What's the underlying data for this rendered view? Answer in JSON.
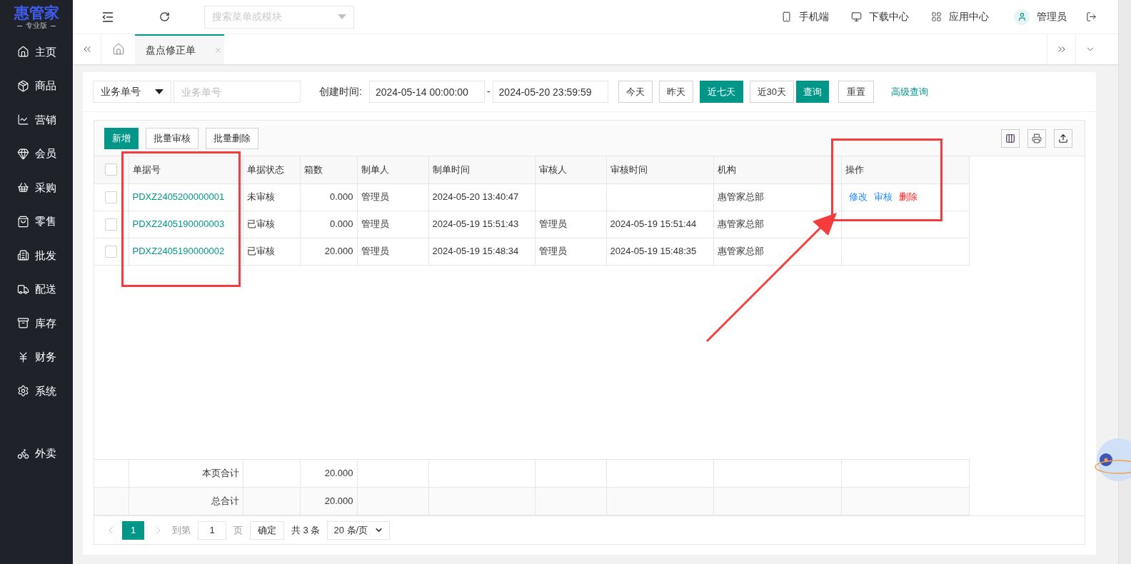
{
  "logo": {
    "title": "惠管家",
    "subtitle": "专业版"
  },
  "sidebar": {
    "items": [
      {
        "label": "主页"
      },
      {
        "label": "商品"
      },
      {
        "label": "营销"
      },
      {
        "label": "会员"
      },
      {
        "label": "采购"
      },
      {
        "label": "零售"
      },
      {
        "label": "批发"
      },
      {
        "label": "配送"
      },
      {
        "label": "库存"
      },
      {
        "label": "财务"
      },
      {
        "label": "系统"
      }
    ],
    "bottom_items": [
      {
        "label": "外卖"
      }
    ]
  },
  "topbar": {
    "search_placeholder": "搜索菜单或模块",
    "links": [
      {
        "label": "手机端"
      },
      {
        "label": "下载中心"
      },
      {
        "label": "应用中心"
      }
    ],
    "user": "管理员"
  },
  "tabs": [
    {
      "label": "盘点修正单",
      "selected": true
    }
  ],
  "filter": {
    "field_select": "业务单号",
    "field_placeholder": "业务单号",
    "created_label": "创建时间:",
    "start": "2024-05-14 00:00:00",
    "separator": "-",
    "end": "2024-05-20 23:59:59",
    "date_ranges": [
      {
        "label": "今天",
        "selected": false
      },
      {
        "label": "昨天",
        "selected": false
      },
      {
        "label": "近七天",
        "selected": true
      },
      {
        "label": "近30天",
        "selected": false
      }
    ],
    "query": "查询",
    "reset": "重置",
    "advanced": "高级查询"
  },
  "toolbar": [
    {
      "label": "新增",
      "kind": "primary"
    },
    {
      "label": "批量审核",
      "kind": "default"
    },
    {
      "label": "批量删除",
      "kind": "default"
    }
  ],
  "table": {
    "select_all_checked": false,
    "columns": [
      "单据号",
      "单据状态",
      "箱数",
      "制单人",
      "制单时间",
      "审核人",
      "审核时间",
      "机构",
      "操作"
    ],
    "rows": [
      {
        "checked": false,
        "cells": [
          "PDXZ2405200000001",
          "未审核",
          "0.000",
          "管理员",
          "2024-05-20 13:40:47",
          "",
          "",
          "惠管家总部"
        ],
        "actions": [
          {
            "label": "修改",
            "kind": "link"
          },
          {
            "label": "审核",
            "kind": "link"
          },
          {
            "label": "删除",
            "kind": "danger"
          }
        ]
      },
      {
        "checked": false,
        "cells": [
          "PDXZ2405190000003",
          "已审核",
          "0.000",
          "管理员",
          "2024-05-19 15:51:43",
          "管理员",
          "2024-05-19 15:51:44",
          "惠管家总部"
        ],
        "actions": []
      },
      {
        "checked": false,
        "cells": [
          "PDXZ2405190000002",
          "已审核",
          "20.000",
          "管理员",
          "2024-05-19 15:48:34",
          "管理员",
          "2024-05-19 15:48:35",
          "惠管家总部"
        ],
        "actions": []
      }
    ],
    "summary": [
      {
        "label": "本页合计",
        "value": "20.000"
      },
      {
        "label": "总合计",
        "value": "20.000"
      }
    ]
  },
  "pagination": {
    "pages": [
      {
        "label": "1",
        "selected": true
      }
    ],
    "goto_label": "到第",
    "page_input": "1",
    "page_unit": "页",
    "confirm": "确定",
    "total": "共 3 条",
    "page_size": "20 条/页"
  },
  "annotations": [
    {
      "kind": "frame"
    },
    {
      "kind": "frame"
    },
    {
      "kind": "arrow"
    }
  ]
}
